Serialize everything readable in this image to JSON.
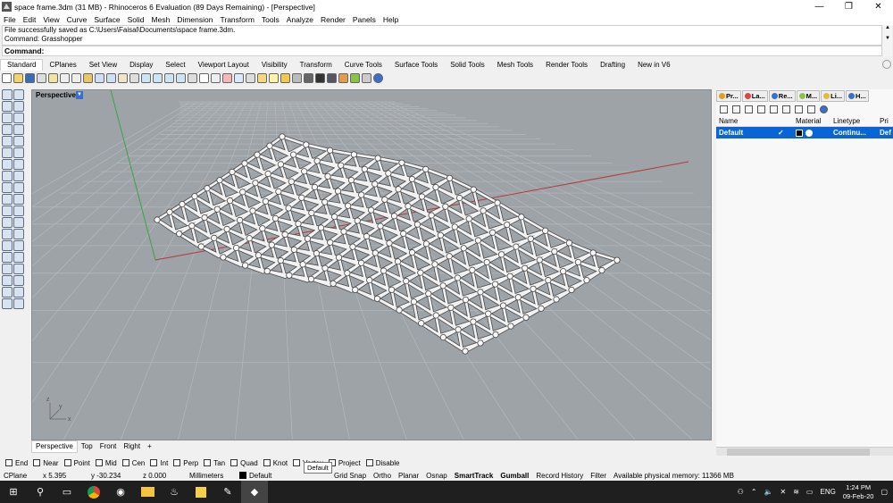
{
  "window": {
    "title": "space frame.3dm (31 MB) - Rhinoceros 6 Evaluation (89 Days Remaining) - [Perspective]",
    "controls": [
      "—",
      "❐",
      "✕"
    ]
  },
  "menu": [
    "File",
    "Edit",
    "View",
    "Curve",
    "Surface",
    "Solid",
    "Mesh",
    "Dimension",
    "Transform",
    "Tools",
    "Analyze",
    "Render",
    "Panels",
    "Help"
  ],
  "command": {
    "history": [
      "File successfully saved as C:\\Users\\Faisal\\Documents\\space frame.3dm.",
      "Command: Grasshopper"
    ],
    "prompt": "Command:"
  },
  "toolbar_tabs": [
    "Standard",
    "CPlanes",
    "Set View",
    "Display",
    "Select",
    "Viewport Layout",
    "Visibility",
    "Transform",
    "Curve Tools",
    "Surface Tools",
    "Solid Tools",
    "Mesh Tools",
    "Render Tools",
    "Drafting",
    "New in V6"
  ],
  "viewport": {
    "title": "Perspective",
    "tabs": [
      "Perspective",
      "Top",
      "Front",
      "Right",
      "+"
    ],
    "axis_labels": [
      "y",
      "x",
      "z"
    ]
  },
  "panel": {
    "tabs": [
      "Pr...",
      "La...",
      "Re...",
      "M...",
      "Li...",
      "H..."
    ],
    "columns": [
      "Name",
      "Material",
      "Linetype",
      "Pri"
    ],
    "row": {
      "name": "Default",
      "linetype": "Continu...",
      "print": "Def"
    }
  },
  "osnap": {
    "items": [
      "End",
      "Near",
      "Point",
      "Mid",
      "Cen",
      "Int",
      "Perp",
      "Tan",
      "Quad",
      "Knot",
      "Vertex",
      "Project",
      "Disable"
    ],
    "tooltip": "Default"
  },
  "status": {
    "cplane": "CPlane",
    "x": "x 5.395",
    "y": "y -30.234",
    "z": "z 0.000",
    "units": "Millimeters",
    "layer": "Default",
    "gridsnap": "Grid Snap",
    "ortho": "Ortho",
    "planar": "Planar",
    "osnap": "Osnap",
    "smarttrack": "SmartTrack",
    "gumball": "Gumball",
    "history": "Record History",
    "filter": "Filter",
    "memory": "Available physical memory: 11366 MB"
  },
  "taskbar": {
    "lang": "ENG",
    "time": "1:24 PM",
    "date": "09-Feb-20"
  }
}
